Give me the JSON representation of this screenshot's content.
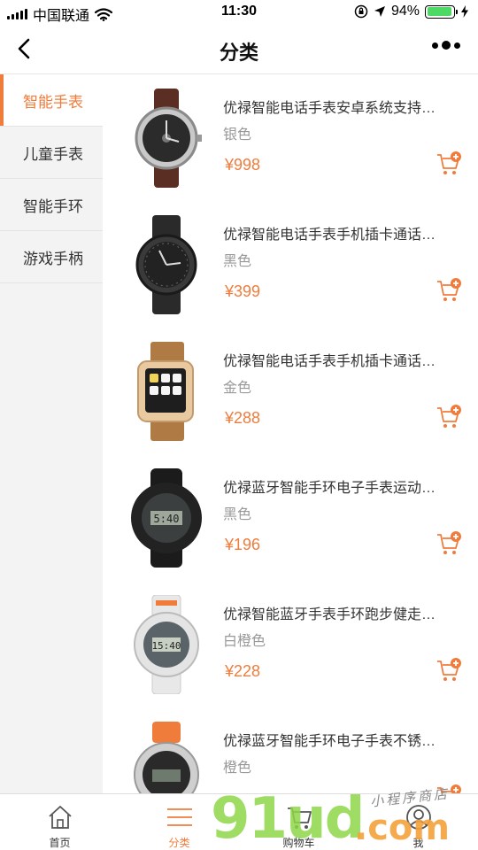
{
  "status_bar": {
    "carrier": "中国联通",
    "time": "11:30",
    "battery": "94%",
    "battery_level": 0.94
  },
  "nav": {
    "title": "分类"
  },
  "sidebar": {
    "items": [
      {
        "label": "智能手表",
        "active": true
      },
      {
        "label": "儿童手表",
        "active": false
      },
      {
        "label": "智能手环",
        "active": false
      },
      {
        "label": "游戏手柄",
        "active": false
      }
    ]
  },
  "products": [
    {
      "title": "优禄智能电话手表安卓系统支持…",
      "variant": "银色",
      "price": "¥998",
      "image": "silver-smartwatch"
    },
    {
      "title": "优禄智能电话手表手机插卡通话…",
      "variant": "黑色",
      "price": "¥399",
      "image": "black-smartwatch"
    },
    {
      "title": "优禄智能电话手表手机插卡通话…",
      "variant": "金色",
      "price": "¥288",
      "image": "gold-smartwatch"
    },
    {
      "title": "优禄蓝牙智能手环电子手表运动…",
      "variant": "黑色",
      "price": "¥196",
      "image": "black-sport-watch"
    },
    {
      "title": "优禄智能蓝牙手表手环跑步健走…",
      "variant": "白橙色",
      "price": "¥228",
      "image": "white-orange-sport-watch"
    },
    {
      "title": "优禄蓝牙智能手环电子手表不锈…",
      "variant": "橙色",
      "price": "",
      "image": "orange-sport-watch"
    }
  ],
  "tabbar": {
    "items": [
      {
        "label": "首页",
        "icon": "home-icon",
        "active": false
      },
      {
        "label": "分类",
        "icon": "menu-icon",
        "active": true
      },
      {
        "label": "购物车",
        "icon": "cart-icon",
        "active": false
      },
      {
        "label": "我",
        "icon": "user-icon",
        "active": false
      }
    ]
  },
  "watermark": {
    "main": "91ud",
    "domain": ".com",
    "sub": "小程序商店"
  },
  "colors": {
    "accent": "#f07c3c",
    "sidebar_bg": "#f3f3f3",
    "battery": "#4cd964"
  }
}
